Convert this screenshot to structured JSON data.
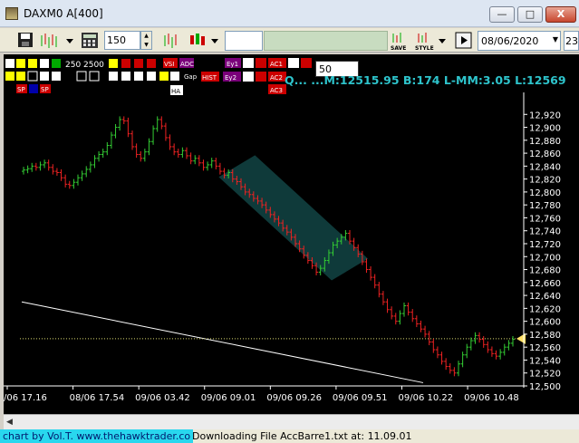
{
  "window": {
    "title": "DAXM0 A[400]",
    "min_label": "—",
    "max_label": "□",
    "close_label": "X"
  },
  "toolbar": {
    "bar_count": "150",
    "date": "08/06/2020",
    "date_cut": "23.",
    "save_label": "SAVE",
    "style_label": "STYLE"
  },
  "indicator_bar": {
    "row1": [
      "250",
      "2500",
      "DS",
      "DS",
      "VSI",
      "ADC",
      "Ey1",
      "AC1"
    ],
    "row2": [
      "HA",
      "Gap",
      "HIST",
      "Ey2",
      "AC2"
    ],
    "row3": [
      "SP",
      "SP",
      "AC3"
    ],
    "hawk_input_value": "50"
  },
  "stats": {
    "text": "Q...  ...M:12515.95 B:174 L-MM:3.05 L:12569"
  },
  "chart_data": {
    "type": "candlestick",
    "title": "",
    "ylim": [
      12500,
      12940
    ],
    "y_ticks": [
      "12,920",
      "12,900",
      "12,880",
      "12,860",
      "12,840",
      "12,820",
      "12,800",
      "12,780",
      "12,760",
      "12,740",
      "12,720",
      "12,700",
      "12,680",
      "12,660",
      "12,640",
      "12,620",
      "12,600",
      "12,580",
      "12,560",
      "12,540",
      "12,520",
      "12,500"
    ],
    "x_ticks": [
      "/06 17.16",
      "08/06 17.54",
      "09/06 03.42",
      "09/06 09.01",
      "09/06 09.26",
      "09/06 09.51",
      "09/06 10.22",
      "09/06 10.48"
    ],
    "reference_level": 12573,
    "current_price_marker": 12573,
    "closes": [
      12834,
      12836,
      12840,
      12838,
      12842,
      12845,
      12838,
      12832,
      12830,
      12822,
      12812,
      12810,
      12815,
      12822,
      12828,
      12835,
      12842,
      12852,
      12858,
      12862,
      12872,
      12888,
      12900,
      12912,
      12910,
      12890,
      12870,
      12858,
      12852,
      12862,
      12878,
      12898,
      12912,
      12902,
      12884,
      12870,
      12862,
      12858,
      12864,
      12856,
      12848,
      12852,
      12845,
      12838,
      12842,
      12848,
      12840,
      12832,
      12826,
      12830,
      12820,
      12816,
      12808,
      12800,
      12796,
      12790,
      12786,
      12780,
      12772,
      12765,
      12758,
      12752,
      12744,
      12738,
      12730,
      12720,
      12712,
      12702,
      12694,
      12686,
      12676,
      12682,
      12694,
      12706,
      12718,
      12724,
      12730,
      12736,
      12724,
      12714,
      12704,
      12692,
      12680,
      12668,
      12656,
      12642,
      12630,
      12618,
      12608,
      12600,
      12612,
      12624,
      12614,
      12604,
      12596,
      12588,
      12580,
      12568,
      12556,
      12548,
      12538,
      12530,
      12524,
      12520,
      12534,
      12548,
      12560,
      12570,
      12578,
      12572,
      12564,
      12556,
      12550,
      12546,
      12552,
      12560,
      12566,
      12572
    ],
    "series": [
      {
        "name": "",
        "kind": "channel",
        "values": [
          12840,
          12680
        ]
      },
      {
        "name": "",
        "kind": "trendline",
        "values": [
          12630,
          12505
        ]
      }
    ]
  },
  "status": {
    "link_text": "chart by Vol.T. www.thehawktrader.co",
    "message": "Downloading File    AccBarre1.txt at: 11.09.01"
  },
  "colors": {
    "up": "#33cc33",
    "down": "#ee2222",
    "channel": "#0f3a3a",
    "stats": "#2ec4cc",
    "axis_text": "#ffffff",
    "link_bg": "#29d7ee"
  }
}
